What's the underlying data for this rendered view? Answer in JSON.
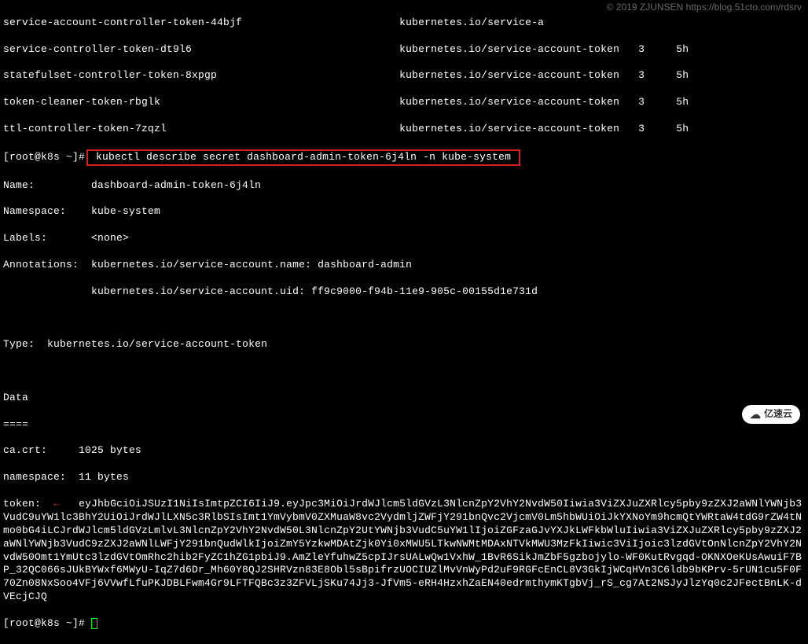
{
  "watermark": "© 2019 ZJUNSEN https://blog.51cto.com/rdsrv",
  "badge_text": "亿速云",
  "top_table": {
    "rows": [
      {
        "name": "service-account-controller-token-44bjf",
        "type": "kubernetes.io/service-a",
        "data": "",
        "age": ""
      },
      {
        "name": "service-controller-token-dt9l6",
        "type": "kubernetes.io/service-account-token",
        "data": "3",
        "age": "5h"
      },
      {
        "name": "statefulset-controller-token-8xpgp",
        "type": "kubernetes.io/service-account-token",
        "data": "3",
        "age": "5h"
      },
      {
        "name": "token-cleaner-token-rbglk",
        "type": "kubernetes.io/service-account-token",
        "data": "3",
        "age": "5h"
      },
      {
        "name": "ttl-controller-token-7zqzl",
        "type": "kubernetes.io/service-account-token",
        "data": "3",
        "age": "5h"
      }
    ]
  },
  "prompt": "[root@k8s ~]#",
  "command": "kubectl describe secret dashboard-admin-token-6j4ln -n kube-system",
  "describe": {
    "name_label": "Name:",
    "name_value": "dashboard-admin-token-6j4ln",
    "namespace_label": "Namespace:",
    "namespace_value": "kube-system",
    "labels_label": "Labels:",
    "labels_value": "<none>",
    "annotations_label": "Annotations:",
    "annotation_sa_name": "kubernetes.io/service-account.name: dashboard-admin",
    "annotation_sa_uid": "kubernetes.io/service-account.uid: ff9c9000-f94b-11e9-905c-00155d1e731d",
    "type_label": "Type:",
    "type_value": "kubernetes.io/service-account-token",
    "data_header": "Data",
    "data_sep": "====",
    "ca_crt_label": "ca.crt:",
    "ca_crt_value": "1025 bytes",
    "ns_label": "namespace:",
    "ns_value": "11 bytes",
    "token_label": "token:",
    "arrow_glyph": "←",
    "token_value": "eyJhbGciOiJSUzI1NiIsImtpZCI6IiJ9.eyJpc3MiOiJrdWJlcm5ldGVzL3NlcnZpY2VhY2NvdW50Iiwia3ViZXJuZXRlcy5pby9zZXJ2aWNlYWNjb3VudC9uYW1lc3BhY2UiOiJrdWJlLXN5c3RlbSIsImt1YmVybmV0ZXMuaW8vc2VydmljZWFjY291bnQvc2VjcmV0Lm5hbWUiOiJkYXNoYm9hcmQtYWRtaW4tdG9rZW4tNmo0bG4iLCJrdWJlcm5ldGVzLmlvL3NlcnZpY2VhY2NvdW50L3NlcnZpY2UtYWNjb3VudC5uYW1lIjoiZGFzaGJvYXJkLWFkbWluIiwia3ViZXJuZXRlcy5pby9zZXJ2aWNlYWNjb3VudC9zZXJ2aWNlLWFjY291bnQudWlkIjoiZmY5YzkwMDAtZjk0Yi0xMWU5LTkwNWMtMDAxNTVkMWU3MzFkIiwic3ViIjoic3lzdGVtOnNlcnZpY2VhY2NvdW50Omt1YmUtc3lzdGVtOmRhc2hib2FyZC1hZG1pbiJ9.AmZleYfuhwZ5cpIJrsUALwQw1VxhW_1BvR6SikJmZbF5gzbojylo-WF0KutRvgqd-OKNXOeKUsAwuiF7BP_32QC066sJUkBYWxf6MWyU-IqZ7d6Dr_Mh60Y8QJ2SHRVzn83E8Obl5sBpifrzUOCIUZlMvVnWyPd2uF9RGFcEnCL8V3GkIjWCqHVn3C6ldb9bKPrv-5rUN1cu5F0F70Zn08NxSoo4VFj6VVwfLfuPKJDBLFwm4Gr9LFTFQBc3z3ZFVLjSKu74Jj3-JfVm5-eRH4HzxhZaEN40edrmthymKTgbVj_rS_cg7At2NSJyJlzYq0c2JFectBnLK-dVEcjCJQ"
  }
}
